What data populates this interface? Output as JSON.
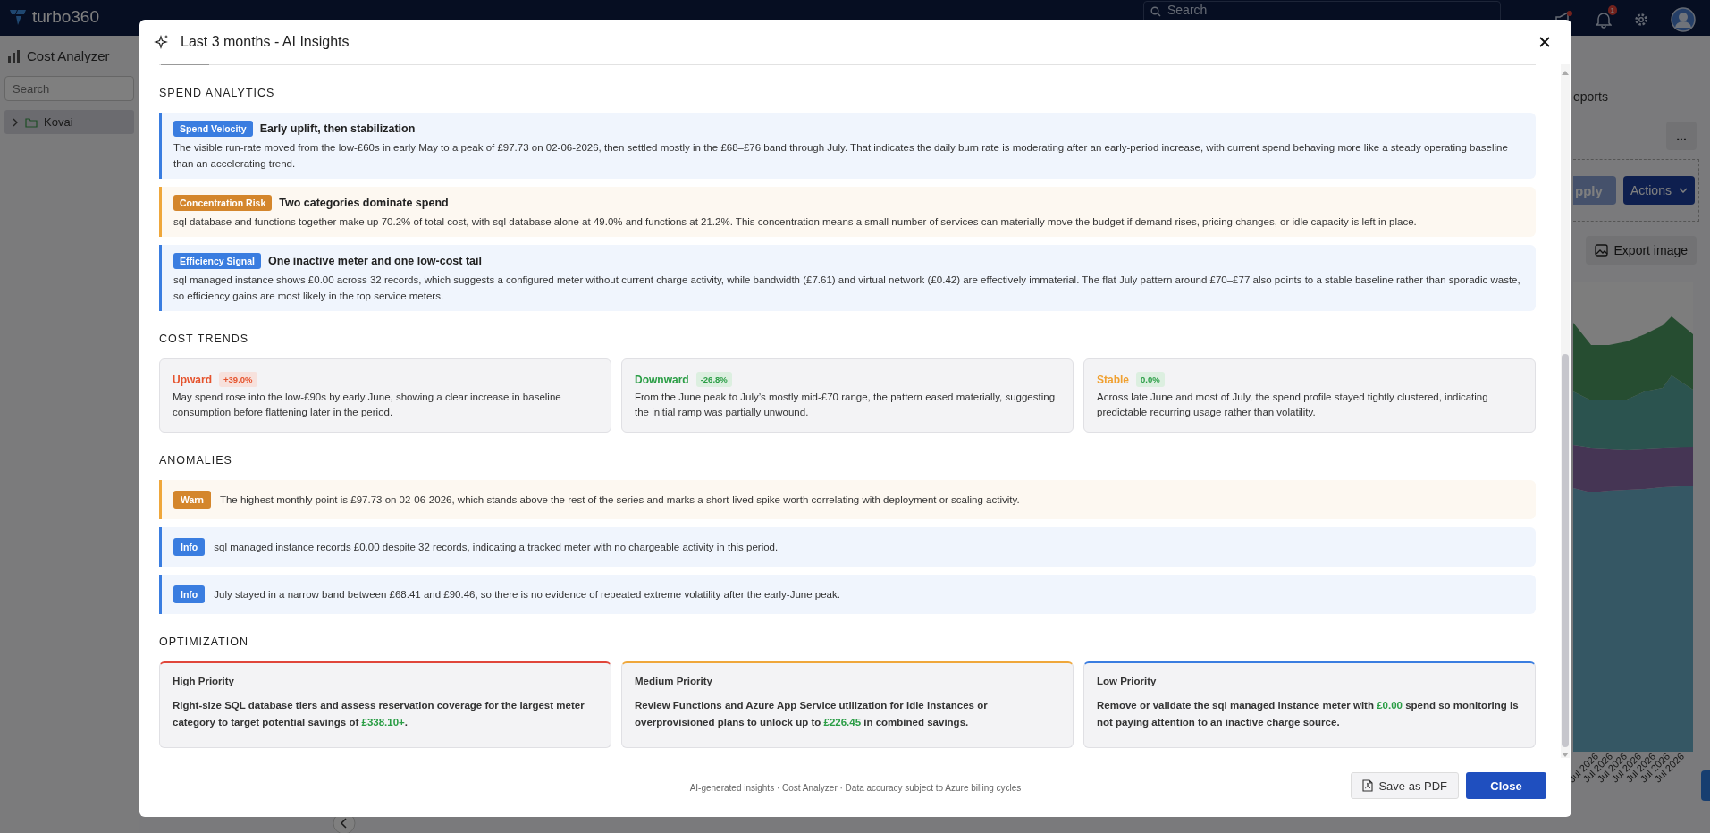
{
  "topbar": {
    "brand": "turbo360",
    "search_placeholder": "Search",
    "notification_count": "1"
  },
  "sidebar": {
    "title": "Cost Analyzer",
    "search_placeholder": "Search",
    "tree": [
      {
        "label": "Kovai",
        "expanded": false,
        "selected": true
      }
    ]
  },
  "background_panel": {
    "tab": "eports",
    "more_button": "...",
    "apply_button": "pply",
    "actions_button": "Actions",
    "export_button": "Export image",
    "x_labels": [
      "Jul 2026",
      "Jul 2026",
      "Jul 2026",
      "Jul 2026",
      "Jul 2026",
      "Jul 2026",
      "Jul 2026"
    ]
  },
  "dialog": {
    "title": "Last 3 months - AI Insights",
    "sections": [
      {
        "kind": "insights",
        "heading": "SPEND ANALYTICS",
        "items": [
          {
            "kind": "info",
            "tag": "Spend Velocity",
            "title": "Early uplift, then stabilization",
            "text": "The visible run-rate moved from the low-£60s in early May to a peak of £97.73 on 02-06-2026, then settled mostly in the £68–£76 band through July. That indicates the daily burn rate is moderating after an early-period increase, with current spend behaving more like a steady operating baseline than an accelerating trend."
          },
          {
            "kind": "warn",
            "tag": "Concentration Risk",
            "title": "Two categories dominate spend",
            "text": "sql database and functions together make up 70.2% of total cost, with sql database alone at 49.0% and functions at 21.2%. This concentration means a small number of services can materially move the budget if demand rises, pricing changes, or idle capacity is left in place."
          },
          {
            "kind": "info",
            "tag": "Efficiency Signal",
            "title": "One inactive meter and one low-cost tail",
            "text": "sql managed instance shows £0.00 across 32 records, which suggests a configured meter without current charge activity, while bandwidth (£7.61) and virtual network (£0.42) are effectively immaterial. The flat July pattern around £70–£77 also points to a stable baseline rather than sporadic waste, so efficiency gains are most likely in the top service meters."
          }
        ]
      },
      {
        "kind": "trends",
        "heading": "COST TRENDS",
        "items": [
          {
            "kind": "up",
            "label": "Upward",
            "change": "+39.0%",
            "text": "May spend rose into the low-£90s by early June, showing a clear increase in baseline consumption before flattening later in the period."
          },
          {
            "kind": "down",
            "label": "Downward",
            "change": "-26.8%",
            "text": "From the June peak to July’s mostly mid-£70 range, the pattern eased materially, suggesting the initial ramp was partially unwound."
          },
          {
            "kind": "stable",
            "label": "Stable",
            "change": "0.0%",
            "text": "Across late June and most of July, the spend profile stayed tightly clustered, indicating predictable recurring usage rather than volatility."
          }
        ]
      },
      {
        "kind": "anomalies",
        "heading": "ANOMALIES",
        "items": [
          {
            "kind": "warn",
            "tag": "Warn",
            "text": "The highest monthly point is £97.73 on 02-06-2026, which stands above the rest of the series and marks a short-lived spike worth correlating with deployment or scaling activity."
          },
          {
            "kind": "info",
            "tag": "Info",
            "text": "sql managed instance records £0.00 despite 32 records, indicating a tracked meter with no chargeable activity in this period."
          },
          {
            "kind": "info",
            "tag": "Info",
            "text": "July stayed in a narrow band between £68.41 and £90.46, so there is no evidence of repeated extreme volatility after the early-June peak."
          }
        ]
      },
      {
        "kind": "optimization",
        "heading": "OPTIMIZATION",
        "items": [
          {
            "kind": "high",
            "label": "High Priority",
            "text": "Right-size SQL database tiers and assess reservation coverage for the largest meter category to target potential savings of **£338.10+**."
          },
          {
            "kind": "medium",
            "label": "Medium Priority",
            "text": "Review Functions and Azure App Service utilization for idle instances or overprovisioned plans to unlock up to **£226.45** in combined savings."
          },
          {
            "kind": "low",
            "label": "Low Priority",
            "text": "Remove or validate the sql managed instance meter with **£0.00** spend so monitoring is not paying attention to an inactive charge source."
          }
        ]
      }
    ],
    "footer_note": "AI-generated insights · Cost Analyzer · Data accuracy subject to Azure billing cycles",
    "buttons": [
      {
        "kind": "secondary",
        "label": "Save as PDF"
      },
      {
        "kind": "primary",
        "label": "Close"
      }
    ]
  }
}
